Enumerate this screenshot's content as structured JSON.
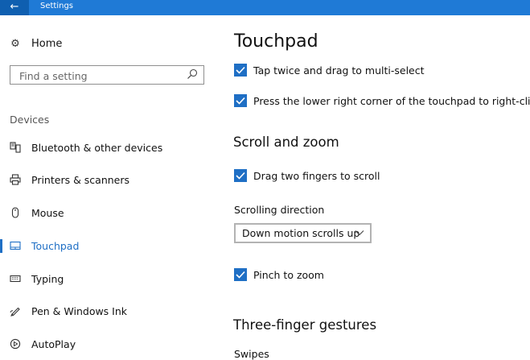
{
  "window": {
    "title": "Settings",
    "back_glyph": "←"
  },
  "sidebar": {
    "home_label": "Home",
    "search_placeholder": "Find a setting",
    "section_label": "Devices",
    "items": [
      {
        "label": "Bluetooth & other devices",
        "icon": "bluetooth-devices-icon"
      },
      {
        "label": "Printers & scanners",
        "icon": "printer-icon"
      },
      {
        "label": "Mouse",
        "icon": "mouse-icon"
      },
      {
        "label": "Touchpad",
        "icon": "touchpad-icon",
        "active": true
      },
      {
        "label": "Typing",
        "icon": "keyboard-icon"
      },
      {
        "label": "Pen & Windows Ink",
        "icon": "pen-icon"
      },
      {
        "label": "AutoPlay",
        "icon": "autoplay-icon"
      }
    ]
  },
  "main": {
    "title": "Touchpad",
    "tap_drag_label": "Tap twice and drag to multi-select",
    "tap_drag_checked": true,
    "right_click_label": "Press the lower right corner of the touchpad to right-click",
    "right_click_checked": true,
    "scroll_zoom_heading": "Scroll and zoom",
    "drag_scroll_label": "Drag two fingers to scroll",
    "drag_scroll_checked": true,
    "scrolling_direction_label": "Scrolling direction",
    "scrolling_direction_value": "Down motion scrolls up",
    "pinch_zoom_label": "Pinch to zoom",
    "pinch_zoom_checked": true,
    "three_finger_heading": "Three-finger gestures",
    "swipes_label": "Swipes"
  },
  "colors": {
    "accent": "#1f6fc5",
    "titlebar": "#1f7ad6"
  }
}
